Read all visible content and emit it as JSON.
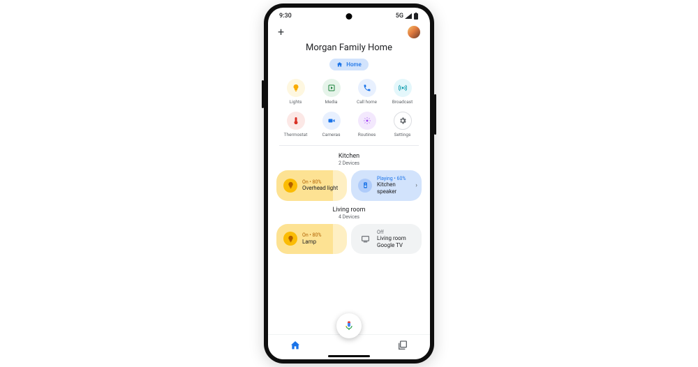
{
  "status": {
    "time": "9:30",
    "network": "5G"
  },
  "header": {
    "title": "Morgan Family Home",
    "chip_label": "Home"
  },
  "shortcuts": [
    {
      "label": "Lights",
      "color": "c-yellow",
      "icon": "bulb"
    },
    {
      "label": "Media",
      "color": "c-green",
      "icon": "play"
    },
    {
      "label": "Call home",
      "color": "c-blue",
      "icon": "phone"
    },
    {
      "label": "Broadcast",
      "color": "c-teal",
      "icon": "broadcast"
    },
    {
      "label": "Thermostat",
      "color": "c-red",
      "icon": "thermo"
    },
    {
      "label": "Cameras",
      "color": "c-blue",
      "icon": "camera"
    },
    {
      "label": "Routines",
      "color": "c-purple",
      "icon": "routines"
    },
    {
      "label": "Settings",
      "color": "c-grey",
      "icon": "gear"
    }
  ],
  "rooms": [
    {
      "name": "Kitchen",
      "sub": "2 Devices",
      "devices": [
        {
          "kind": "light",
          "status": "On • 80%",
          "name": "Overhead light"
        },
        {
          "kind": "speaker",
          "status": "Playing • 60%",
          "name": "Kitchen speaker"
        }
      ]
    },
    {
      "name": "Living room",
      "sub": "4 Devices",
      "devices": [
        {
          "kind": "light",
          "status": "On • 80%",
          "name": "Lamp"
        },
        {
          "kind": "tv",
          "status": "Off",
          "name": "Living room Google TV"
        }
      ]
    }
  ]
}
